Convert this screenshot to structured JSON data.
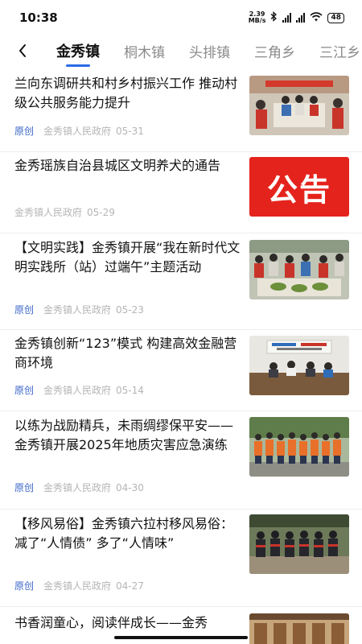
{
  "status": {
    "time": "10:38",
    "speed_value": "2.39",
    "speed_unit": "MB/s",
    "battery": "48"
  },
  "tabs": [
    "金秀镇",
    "桐木镇",
    "头排镇",
    "三角乡",
    "三江乡"
  ],
  "articles": [
    {
      "title": "兰向东调研共和村乡村振兴工作 推动村级公共服务能力提升",
      "tag": "原创",
      "source": "金秀镇人民政府",
      "date": "05-31"
    },
    {
      "title": "金秀瑶族自治县城区文明养犬的通告",
      "tag": "",
      "source": "金秀镇人民政府",
      "date": "05-29",
      "image_text": "公告"
    },
    {
      "title": "【文明实践】金秀镇开展“我在新时代文明实践所（站）过端午”主题活动",
      "tag": "原创",
      "source": "金秀镇人民政府",
      "date": "05-23"
    },
    {
      "title": "金秀镇创新“123”模式 构建高效金融营商环境",
      "tag": "原创",
      "source": "金秀镇人民政府",
      "date": "05-14"
    },
    {
      "title": "以练为战励精兵，未雨绸缪保平安——金秀镇开展2025年地质灾害应急演练",
      "tag": "原创",
      "source": "金秀镇人民政府",
      "date": "04-30"
    },
    {
      "title": "【移风易俗】金秀镇六拉村移风易俗：减了“人情债” 多了“人情味”",
      "tag": "原创",
      "source": "金秀镇人民政府",
      "date": "04-27"
    },
    {
      "title": "书香润童心，阅读伴成长——金秀",
      "tag": "",
      "source": "",
      "date": ""
    }
  ]
}
